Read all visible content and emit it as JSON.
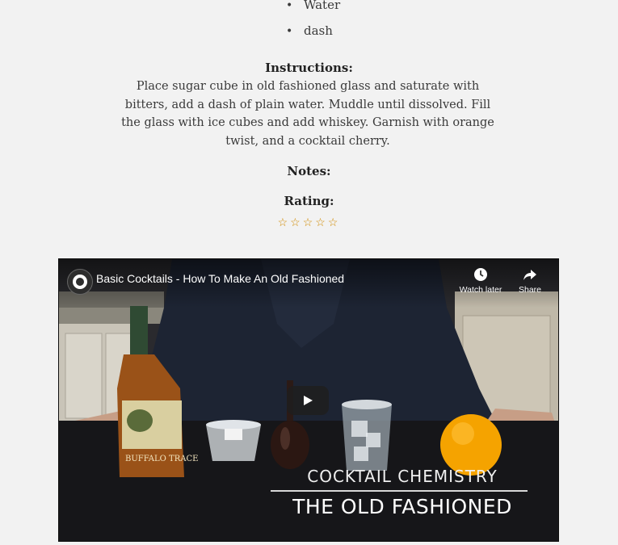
{
  "ingredients": [
    {
      "bullet": "•",
      "text": "Water"
    },
    {
      "bullet": "•",
      "text": "dash"
    }
  ],
  "instructions": {
    "label": "Instructions:",
    "text": "Place sugar cube in old fashioned glass and saturate with bitters, add a dash of plain water. Muddle until dissolved. Fill the glass with ice cubes and add whiskey. Garnish with orange twist, and a cocktail cherry."
  },
  "notes": {
    "label": "Notes:"
  },
  "rating": {
    "label": "Rating:",
    "stars": "☆☆☆☆☆",
    "value": 0,
    "max": 5
  },
  "video": {
    "title": "Basic Cocktails - How To Make An Old Fashioned",
    "watch_later": "Watch later",
    "share": "Share",
    "overlay_subtitle": "COCKTAIL CHEMISTRY",
    "overlay_title": "THE OLD FASHIONED",
    "bottle_label": "BUFFALO TRACE",
    "icons": {
      "channel": "channel-avatar-icon",
      "watch_later": "clock-icon",
      "share": "share-arrow-icon",
      "play": "play-icon"
    }
  },
  "colors": {
    "page_background": "#f2f2f2",
    "star_color": "#d08a00",
    "text": "#3a3a3a"
  }
}
